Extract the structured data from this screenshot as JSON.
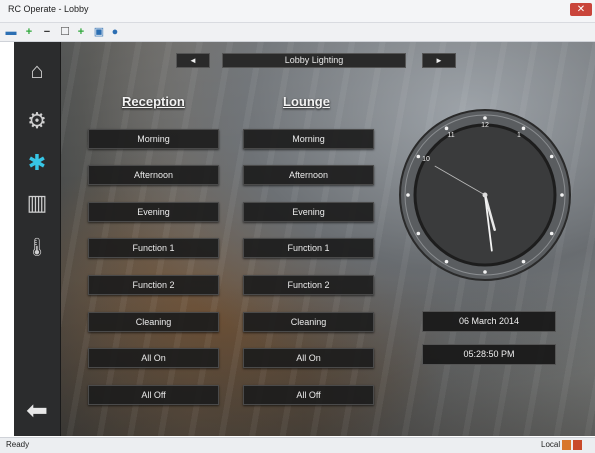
{
  "window": {
    "title": "RC Operate - Lobby",
    "close_glyph": "✕"
  },
  "toolbar": {
    "icons": [
      "save-icon",
      "add-icon",
      "remove-icon",
      "window-icon",
      "add-icon",
      "monitor-icon",
      "help-icon"
    ]
  },
  "sidebar": {
    "items": [
      {
        "name": "home-icon",
        "glyph": "⌂"
      },
      {
        "name": "settings-icon",
        "glyph": "⚙"
      },
      {
        "name": "lighting-icon",
        "glyph": "✱",
        "active": true
      },
      {
        "name": "door-icon",
        "glyph": "▥"
      },
      {
        "name": "temperature-icon",
        "glyph": "🌡"
      }
    ],
    "back_glyph": "⬅"
  },
  "nav": {
    "prev": "◄",
    "next": "►",
    "title": "Lobby Lighting"
  },
  "columns": [
    {
      "heading": "Reception",
      "buttons": [
        "Morning",
        "Afternoon",
        "Evening",
        "Function 1",
        "Function 2",
        "Cleaning",
        "All On",
        "All Off"
      ]
    },
    {
      "heading": "Lounge",
      "buttons": [
        "Morning",
        "Afternoon",
        "Evening",
        "Function 1",
        "Function 2",
        "Cleaning",
        "All On",
        "All Off"
      ]
    }
  ],
  "clock": {
    "hours": 5,
    "minutes": 28,
    "seconds": 50,
    "numerals": [
      "12",
      "1",
      "11",
      "10"
    ]
  },
  "date": "06 March 2014",
  "time": "05:28:50 PM",
  "status": {
    "left": "Ready",
    "right": "Local"
  }
}
